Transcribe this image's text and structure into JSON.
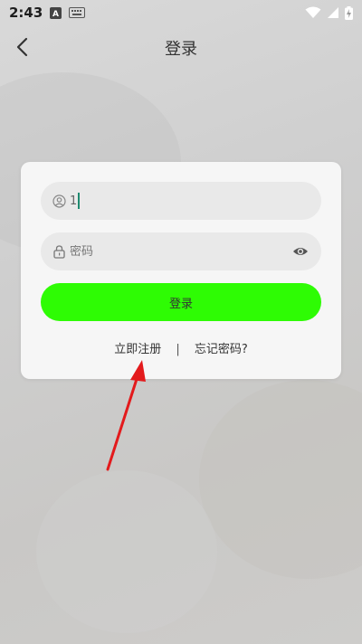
{
  "status_bar": {
    "time": "2:43",
    "icons": [
      "a-box-icon",
      "keyboard-icon",
      "wifi-icon",
      "signal-icon",
      "battery-charging-icon"
    ]
  },
  "header": {
    "title": "登录"
  },
  "form": {
    "username_value": "1",
    "password_placeholder": "密码",
    "login_label": "登录"
  },
  "links": {
    "register_label": "立即注册",
    "separator": "|",
    "forgot_label": "忘记密码?"
  },
  "colors": {
    "login_button": "#2efc04",
    "caret": "#1f8a70",
    "annotation_arrow": "#e31a1c"
  }
}
